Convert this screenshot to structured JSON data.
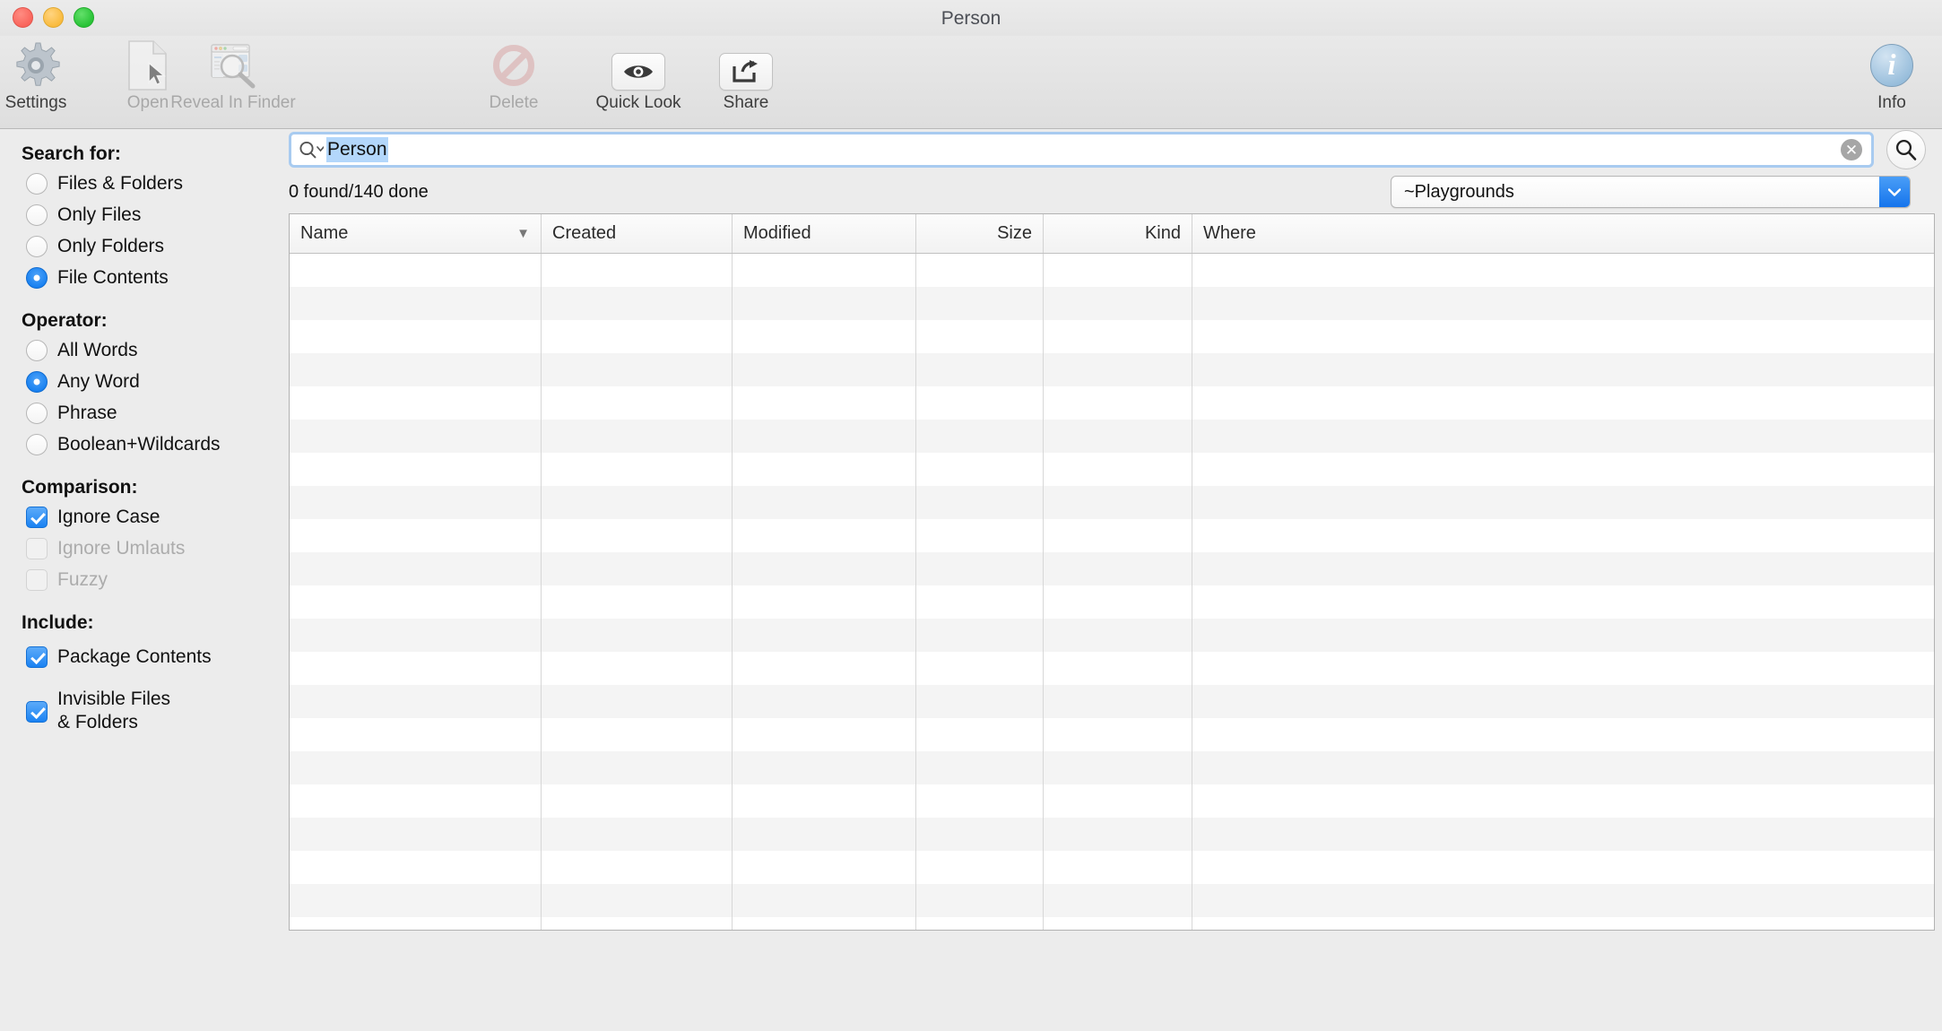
{
  "window": {
    "title": "Person",
    "traffic_lights": [
      "close",
      "minimize",
      "maximize"
    ]
  },
  "toolbar": {
    "items": [
      {
        "label": "Settings",
        "icon": "gear-icon",
        "enabled": true
      },
      {
        "label": "Open",
        "icon": "document-cursor-icon",
        "enabled": false
      },
      {
        "label": "Reveal In Finder",
        "icon": "finder-magnifier-icon",
        "enabled": false
      },
      {
        "label": "Delete",
        "icon": "prohibited-icon",
        "enabled": false
      },
      {
        "label": "Quick Look",
        "icon": "eye-icon",
        "enabled": true
      },
      {
        "label": "Share",
        "icon": "share-arrow-icon",
        "enabled": true
      },
      {
        "label": "Info",
        "icon": "info-circle-icon",
        "enabled": true
      }
    ]
  },
  "sidebar": {
    "search_for": {
      "title": "Search for:",
      "options": [
        {
          "label": "Files & Folders",
          "selected": false
        },
        {
          "label": "Only Files",
          "selected": false
        },
        {
          "label": "Only Folders",
          "selected": false
        },
        {
          "label": "File Contents",
          "selected": true
        }
      ]
    },
    "operator": {
      "title": "Operator:",
      "options": [
        {
          "label": "All Words",
          "selected": false
        },
        {
          "label": "Any Word",
          "selected": true
        },
        {
          "label": "Phrase",
          "selected": false
        },
        {
          "label": "Boolean+Wildcards",
          "selected": false
        }
      ]
    },
    "comparison": {
      "title": "Comparison:",
      "options": [
        {
          "label": "Ignore Case",
          "checked": true,
          "enabled": true
        },
        {
          "label": "Ignore Umlauts",
          "checked": false,
          "enabled": false
        },
        {
          "label": "Fuzzy",
          "checked": false,
          "enabled": false
        }
      ]
    },
    "include": {
      "title": "Include:",
      "options": [
        {
          "label": "Package Contents",
          "checked": true,
          "enabled": true
        },
        {
          "label": "Invisible Files",
          "label2": "& Folders",
          "checked": true,
          "enabled": true
        }
      ]
    }
  },
  "search": {
    "value": "Person",
    "placeholder": "",
    "clear_label": "✕",
    "magnifier_chevron": "search-dropdown-icon",
    "search_button_icon": "search-icon"
  },
  "status": {
    "text": "0 found/140 done"
  },
  "location": {
    "selected": "~Playgrounds",
    "options": [
      "~Playgrounds"
    ]
  },
  "results_table": {
    "columns": [
      {
        "label": "Name",
        "align": "left",
        "sorted": true,
        "sort_caret": "▼"
      },
      {
        "label": "Created",
        "align": "left",
        "sorted": false
      },
      {
        "label": "Modified",
        "align": "left",
        "sorted": false
      },
      {
        "label": "Size",
        "align": "right",
        "sorted": false
      },
      {
        "label": "Kind",
        "align": "right",
        "sorted": false
      },
      {
        "label": "Where",
        "align": "left",
        "sorted": false
      }
    ],
    "rows": [],
    "empty_row_count": 21
  },
  "colors": {
    "accent_blue": "#1a82f2",
    "selection_blue": "#b3d7fb",
    "focus_ring": "#a8cbf0",
    "sidebar_bg": "#ececec",
    "row_alt": "#f4f4f4",
    "disabled_text": "#a8a8a8"
  }
}
